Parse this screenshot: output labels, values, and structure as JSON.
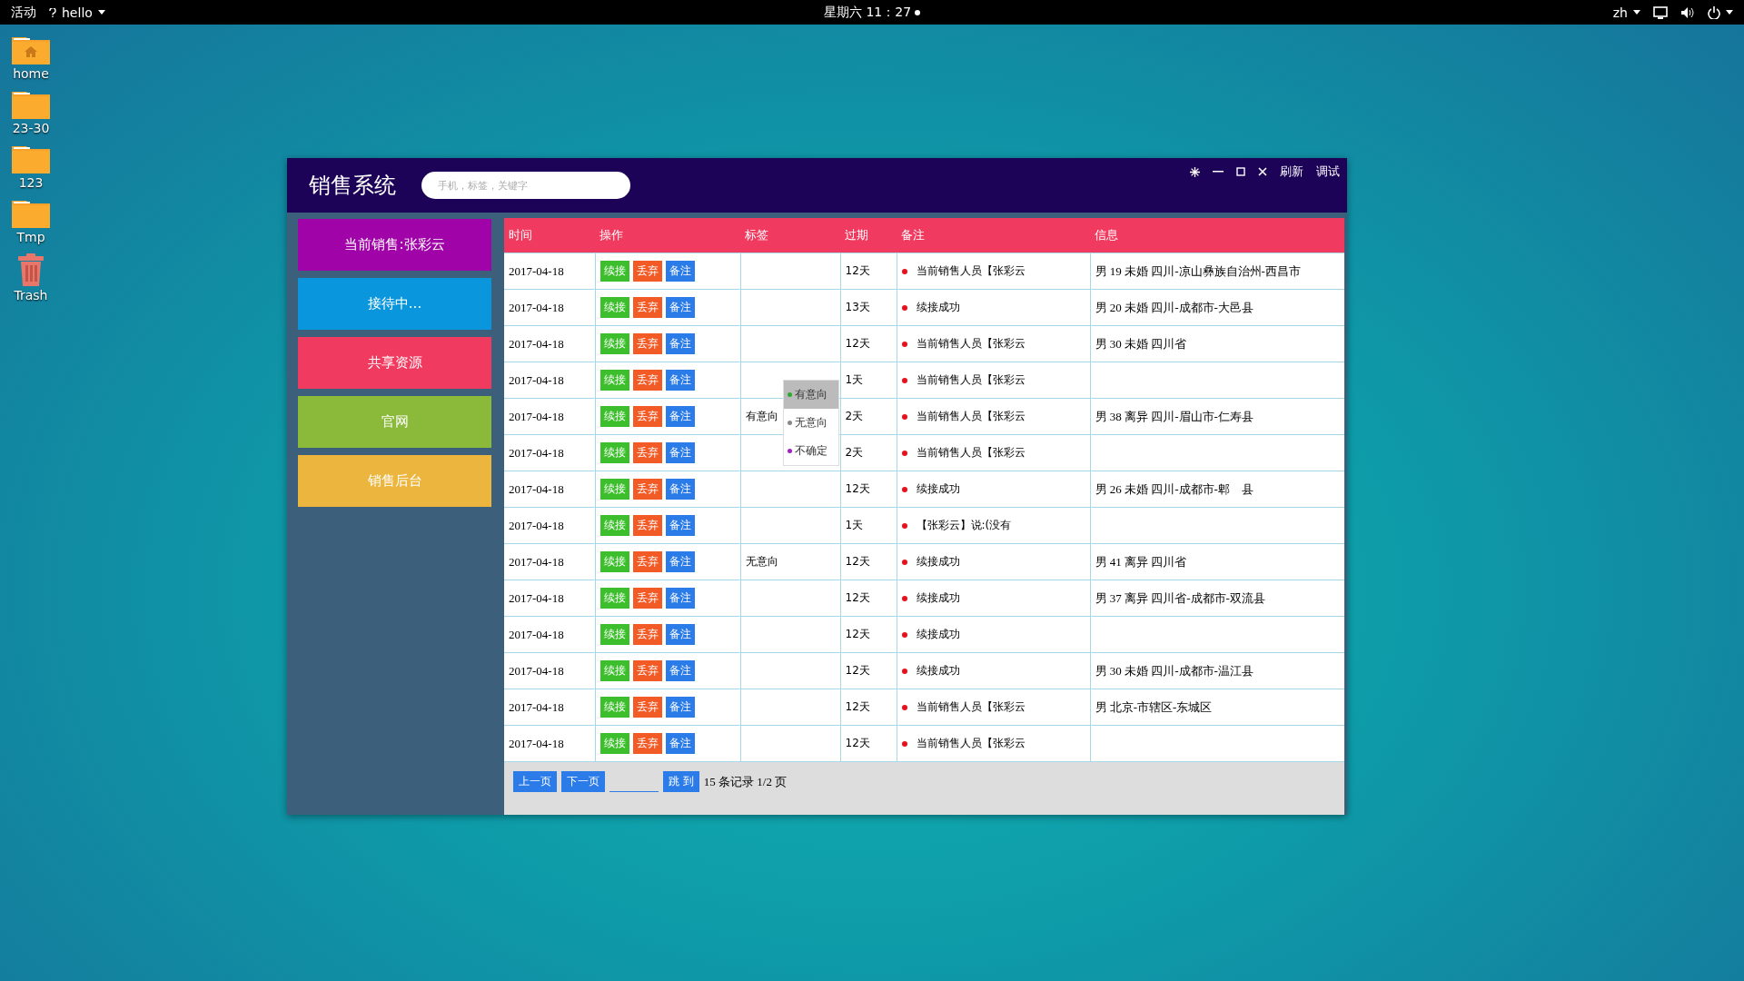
{
  "top_bar": {
    "activities": "活动",
    "app_menu": "hello",
    "clock": "星期六 11：27",
    "language": "zh"
  },
  "desktop_icons": [
    {
      "label": "home",
      "kind": "home"
    },
    {
      "label": "23-30",
      "kind": "folder"
    },
    {
      "label": "123",
      "kind": "folder"
    },
    {
      "label": "Tmp",
      "kind": "folder"
    },
    {
      "label": "Trash",
      "kind": "trash"
    }
  ],
  "app": {
    "title": "销售系统",
    "search": {
      "placeholder": "手机，标签，关键字"
    },
    "header_buttons": [
      "刷新",
      "调试"
    ],
    "sidebar": {
      "items": [
        {
          "label": "当前销售:张彩云",
          "color": "#a003a8"
        },
        {
          "label": "接待中...",
          "color": "#0a96dc"
        },
        {
          "label": "共享资源",
          "color": "#f03a5f"
        },
        {
          "label": "官网",
          "color": "#8bb93a"
        },
        {
          "label": "销售后台",
          "color": "#ecb53e"
        }
      ]
    },
    "table": {
      "columns": [
        "时间",
        "操作",
        "标签",
        "过期",
        "备注",
        "信息"
      ],
      "rows": [
        {
          "time": "2017-04-18",
          "actions": [
            "续接",
            "丢弃",
            "备注"
          ],
          "expiry": "12天",
          "note": "当前销售人员【张彩云",
          "info": "男 19 未婚 四川-凉山彝族自治州-西昌市"
        },
        {
          "time": "2017-04-18",
          "actions": [
            "续接",
            "丢弃",
            "备注"
          ],
          "expiry": "13天",
          "note": "续接成功",
          "info": "男 20 未婚 四川-成都市-大邑县"
        },
        {
          "time": "2017-04-18",
          "actions": [
            "续接",
            "丢弃",
            "备注"
          ],
          "expiry": "12天",
          "note": "当前销售人员【张彩云",
          "info": "男 30 未婚 四川省"
        },
        {
          "time": "2017-04-18",
          "actions": [
            "续接",
            "丢弃",
            "备注"
          ],
          "expiry": "1天",
          "note": "当前销售人员【张彩云"
        },
        {
          "time": "2017-04-18",
          "actions": [
            "续接",
            "丢弃",
            "备注"
          ],
          "tag": "有意向",
          "expiry": "2天",
          "note": "当前销售人员【张彩云",
          "info": "男 38 离异 四川-眉山市-仁寿县"
        },
        {
          "time": "2017-04-18",
          "actions": [
            "续接",
            "丢弃",
            "备注"
          ],
          "expiry": "2天",
          "note": "当前销售人员【张彩云"
        },
        {
          "time": "2017-04-18",
          "actions": [
            "续接",
            "丢弃",
            "备注"
          ],
          "expiry": "12天",
          "note": "续接成功",
          "info": "男 26 未婚 四川-成都市-郫　县"
        },
        {
          "time": "2017-04-18",
          "actions": [
            "续接",
            "丢弃",
            "备注"
          ],
          "expiry": "1天",
          "note": "【张彩云】说:(没有"
        },
        {
          "time": "2017-04-18",
          "actions": [
            "续接",
            "丢弃",
            "备注"
          ],
          "tag": "无意向",
          "expiry": "12天",
          "note": "续接成功",
          "info": "男 41 离异 四川省"
        },
        {
          "time": "2017-04-18",
          "actions": [
            "续接",
            "丢弃",
            "备注"
          ],
          "expiry": "12天",
          "note": "续接成功",
          "info": "男 37 离异 四川省-成都市-双流县"
        },
        {
          "time": "2017-04-18",
          "actions": [
            "续接",
            "丢弃",
            "备注"
          ],
          "expiry": "12天",
          "note": "续接成功"
        },
        {
          "time": "2017-04-18",
          "actions": [
            "续接",
            "丢弃",
            "备注"
          ],
          "expiry": "12天",
          "note": "续接成功",
          "info": "男 30 未婚 四川-成都市-温江县"
        },
        {
          "time": "2017-04-18",
          "actions": [
            "续接",
            "丢弃",
            "备注"
          ],
          "expiry": "12天",
          "note": "当前销售人员【张彩云",
          "info": "男 北京-市辖区-东城区"
        },
        {
          "time": "2017-04-18",
          "actions": [
            "续接",
            "丢弃",
            "备注"
          ],
          "expiry": "12天",
          "note": "当前销售人员【张彩云"
        }
      ]
    },
    "tag_menu": {
      "items": [
        {
          "label": "有意向",
          "color": "#2eaa2e",
          "selected": true
        },
        {
          "label": "无意向",
          "color": "#888888",
          "selected": false
        },
        {
          "label": "不确定",
          "color": "#a020c0",
          "selected": false
        }
      ]
    },
    "pagination": {
      "prev": "上一页",
      "next": "下一页",
      "go": "跳 到",
      "summary": "15 条记录 1/2 页"
    }
  }
}
